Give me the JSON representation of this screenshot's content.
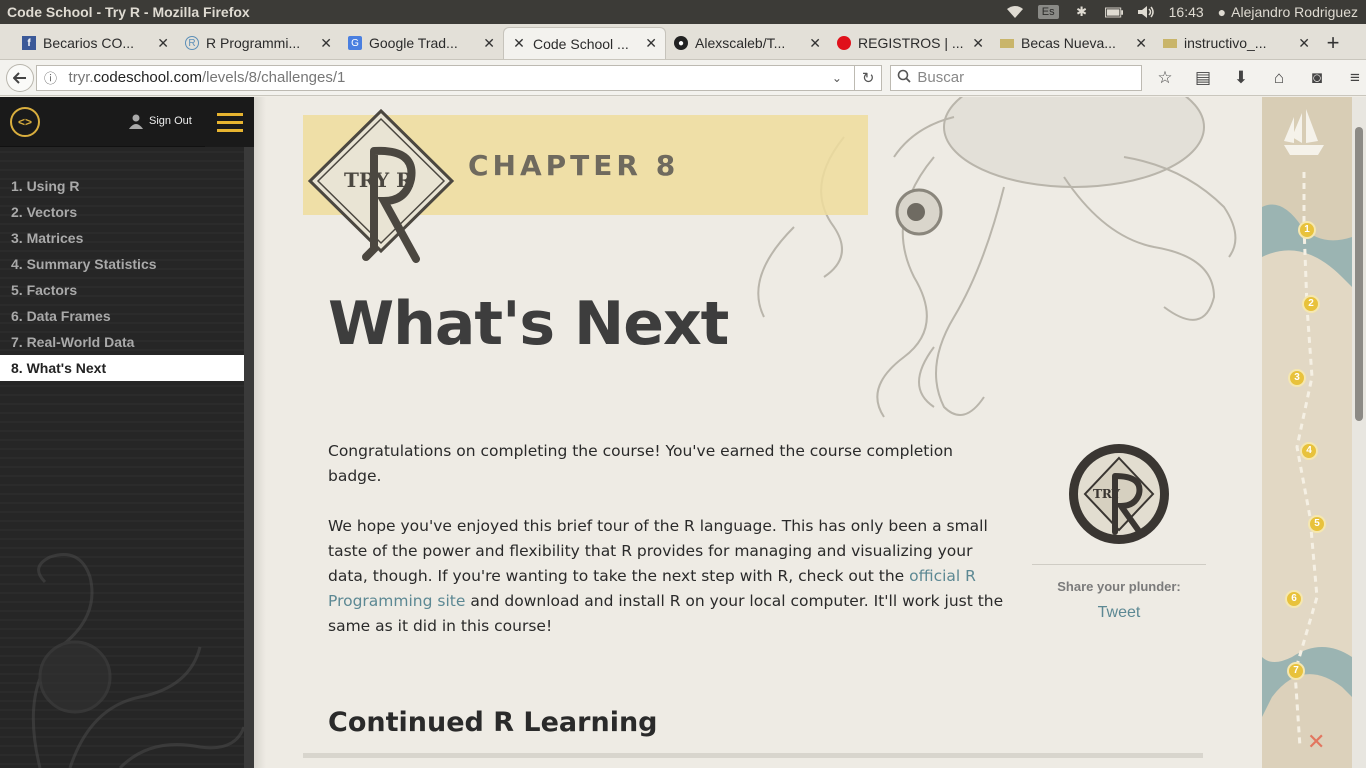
{
  "os": {
    "window_title": "Code School - Try R - Mozilla Firefox",
    "keyboard": "Es",
    "time": "16:43",
    "user": "Alejandro Rodriguez"
  },
  "tabs": [
    {
      "label": "Becarios CO...",
      "icon": "facebook-icon"
    },
    {
      "label": "R Programmi...",
      "icon": "r-icon"
    },
    {
      "label": "Google Trad...",
      "icon": "google-translate-icon"
    },
    {
      "label": "Code School ...",
      "icon": "tools-icon"
    },
    {
      "label": "Alexscaleb/T...",
      "icon": "github-icon"
    },
    {
      "label": "REGISTROS | ...",
      "icon": "red-dot-icon"
    },
    {
      "label": "Becas Nueva...",
      "icon": "page-icon"
    },
    {
      "label": "instructivo_...",
      "icon": "page-icon"
    }
  ],
  "nav": {
    "url_prefix": "tryr.",
    "url_domain": "codeschool.com",
    "url_path": "/levels/8/challenges/1",
    "search_placeholder": "Buscar"
  },
  "sidebar": {
    "sign_out": "Sign Out",
    "items": [
      {
        "label": "1. Using R"
      },
      {
        "label": "2. Vectors"
      },
      {
        "label": "3. Matrices"
      },
      {
        "label": "4. Summary Statistics"
      },
      {
        "label": "5. Factors"
      },
      {
        "label": "6. Data Frames"
      },
      {
        "label": "7. Real-World Data"
      },
      {
        "label": "8. What's Next"
      }
    ]
  },
  "main": {
    "logo_text": "TRY R",
    "chapter": "CHAPTER 8",
    "title": "What's Next",
    "para1": "Congratulations on completing the course! You've earned the course completion badge.",
    "para2_before": "We hope you've enjoyed this brief tour of the R language. This has only been a small taste of the power and flexibility that R provides for managing and visualizing your data, though. If you're wanting to take the next step with R, check out the ",
    "para2_link": "official R Programming site",
    "para2_after": " and download and install R on your local computer. It'll work just the same as it did in this course!",
    "share_label": "Share your plunder:",
    "tweet": "Tweet",
    "section_title": "Continued R Learning"
  },
  "map": {
    "nodes": [
      "1",
      "2",
      "3",
      "4",
      "5",
      "6",
      "7"
    ],
    "end_marker": "✕"
  },
  "colors": {
    "accent_gold": "#e7b430",
    "link": "#5c8893",
    "chapter_band": "#eedd9c"
  }
}
